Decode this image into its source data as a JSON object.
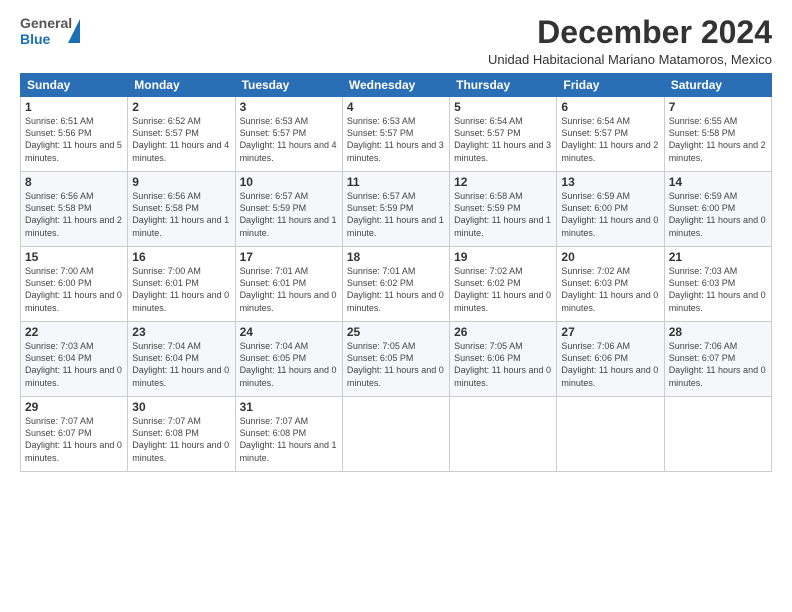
{
  "header": {
    "logo_general": "General",
    "logo_blue": "Blue",
    "month_title": "December 2024",
    "subtitle": "Unidad Habitacional Mariano Matamoros, Mexico"
  },
  "calendar": {
    "days_of_week": [
      "Sunday",
      "Monday",
      "Tuesday",
      "Wednesday",
      "Thursday",
      "Friday",
      "Saturday"
    ],
    "weeks": [
      [
        {
          "day": "1",
          "sunrise": "6:51 AM",
          "sunset": "5:56 PM",
          "daylight": "11 hours and 5 minutes."
        },
        {
          "day": "2",
          "sunrise": "6:52 AM",
          "sunset": "5:57 PM",
          "daylight": "11 hours and 4 minutes."
        },
        {
          "day": "3",
          "sunrise": "6:53 AM",
          "sunset": "5:57 PM",
          "daylight": "11 hours and 4 minutes."
        },
        {
          "day": "4",
          "sunrise": "6:53 AM",
          "sunset": "5:57 PM",
          "daylight": "11 hours and 3 minutes."
        },
        {
          "day": "5",
          "sunrise": "6:54 AM",
          "sunset": "5:57 PM",
          "daylight": "11 hours and 3 minutes."
        },
        {
          "day": "6",
          "sunrise": "6:54 AM",
          "sunset": "5:57 PM",
          "daylight": "11 hours and 2 minutes."
        },
        {
          "day": "7",
          "sunrise": "6:55 AM",
          "sunset": "5:58 PM",
          "daylight": "11 hours and 2 minutes."
        }
      ],
      [
        {
          "day": "8",
          "sunrise": "6:56 AM",
          "sunset": "5:58 PM",
          "daylight": "11 hours and 2 minutes."
        },
        {
          "day": "9",
          "sunrise": "6:56 AM",
          "sunset": "5:58 PM",
          "daylight": "11 hours and 1 minute."
        },
        {
          "day": "10",
          "sunrise": "6:57 AM",
          "sunset": "5:59 PM",
          "daylight": "11 hours and 1 minute."
        },
        {
          "day": "11",
          "sunrise": "6:57 AM",
          "sunset": "5:59 PM",
          "daylight": "11 hours and 1 minute."
        },
        {
          "day": "12",
          "sunrise": "6:58 AM",
          "sunset": "5:59 PM",
          "daylight": "11 hours and 1 minute."
        },
        {
          "day": "13",
          "sunrise": "6:59 AM",
          "sunset": "6:00 PM",
          "daylight": "11 hours and 0 minutes."
        },
        {
          "day": "14",
          "sunrise": "6:59 AM",
          "sunset": "6:00 PM",
          "daylight": "11 hours and 0 minutes."
        }
      ],
      [
        {
          "day": "15",
          "sunrise": "7:00 AM",
          "sunset": "6:00 PM",
          "daylight": "11 hours and 0 minutes."
        },
        {
          "day": "16",
          "sunrise": "7:00 AM",
          "sunset": "6:01 PM",
          "daylight": "11 hours and 0 minutes."
        },
        {
          "day": "17",
          "sunrise": "7:01 AM",
          "sunset": "6:01 PM",
          "daylight": "11 hours and 0 minutes."
        },
        {
          "day": "18",
          "sunrise": "7:01 AM",
          "sunset": "6:02 PM",
          "daylight": "11 hours and 0 minutes."
        },
        {
          "day": "19",
          "sunrise": "7:02 AM",
          "sunset": "6:02 PM",
          "daylight": "11 hours and 0 minutes."
        },
        {
          "day": "20",
          "sunrise": "7:02 AM",
          "sunset": "6:03 PM",
          "daylight": "11 hours and 0 minutes."
        },
        {
          "day": "21",
          "sunrise": "7:03 AM",
          "sunset": "6:03 PM",
          "daylight": "11 hours and 0 minutes."
        }
      ],
      [
        {
          "day": "22",
          "sunrise": "7:03 AM",
          "sunset": "6:04 PM",
          "daylight": "11 hours and 0 minutes."
        },
        {
          "day": "23",
          "sunrise": "7:04 AM",
          "sunset": "6:04 PM",
          "daylight": "11 hours and 0 minutes."
        },
        {
          "day": "24",
          "sunrise": "7:04 AM",
          "sunset": "6:05 PM",
          "daylight": "11 hours and 0 minutes."
        },
        {
          "day": "25",
          "sunrise": "7:05 AM",
          "sunset": "6:05 PM",
          "daylight": "11 hours and 0 minutes."
        },
        {
          "day": "26",
          "sunrise": "7:05 AM",
          "sunset": "6:06 PM",
          "daylight": "11 hours and 0 minutes."
        },
        {
          "day": "27",
          "sunrise": "7:06 AM",
          "sunset": "6:06 PM",
          "daylight": "11 hours and 0 minutes."
        },
        {
          "day": "28",
          "sunrise": "7:06 AM",
          "sunset": "6:07 PM",
          "daylight": "11 hours and 0 minutes."
        }
      ],
      [
        {
          "day": "29",
          "sunrise": "7:07 AM",
          "sunset": "6:07 PM",
          "daylight": "11 hours and 0 minutes."
        },
        {
          "day": "30",
          "sunrise": "7:07 AM",
          "sunset": "6:08 PM",
          "daylight": "11 hours and 0 minutes."
        },
        {
          "day": "31",
          "sunrise": "7:07 AM",
          "sunset": "6:08 PM",
          "daylight": "11 hours and 1 minute."
        },
        null,
        null,
        null,
        null
      ]
    ]
  }
}
